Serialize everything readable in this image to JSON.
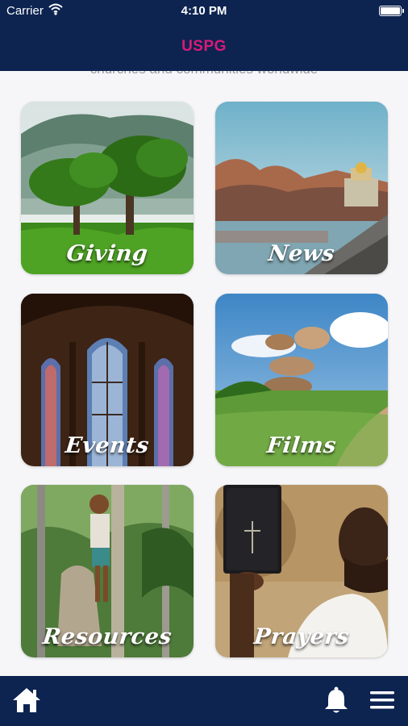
{
  "status_bar": {
    "carrier": "Carrier",
    "time": "4:10 PM",
    "icons": [
      "wifi-icon",
      "battery-icon"
    ]
  },
  "nav": {
    "title": "USPG",
    "title_color": "#d81b77",
    "bar_color": "#0d2350"
  },
  "content": {
    "tagline": "churches and communities worldwide"
  },
  "tiles": [
    {
      "label": "Giving"
    },
    {
      "label": "News"
    },
    {
      "label": "Events"
    },
    {
      "label": "Films"
    },
    {
      "label": "Resources"
    },
    {
      "label": "Prayers"
    }
  ],
  "tab_bar": {
    "icons": [
      "home-icon",
      "bell-icon",
      "menu-icon"
    ]
  }
}
